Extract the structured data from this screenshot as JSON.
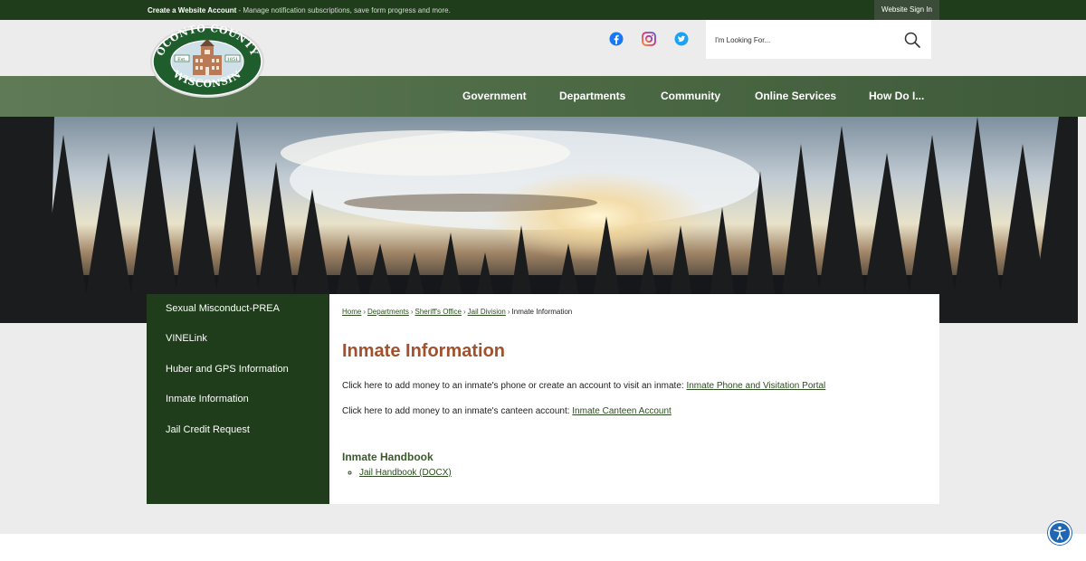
{
  "topbar": {
    "create_account": "Create a Website Account",
    "create_account_desc": " - Manage notification subscriptions, save form progress and more.",
    "sign_in": "Website Sign In"
  },
  "logo": {
    "name": "Oconto County Wisconsin logo",
    "top_text": "OCONTO COUNTY",
    "bottom_text": "WISCONSIN",
    "est": "Est.",
    "year": "1851"
  },
  "social": [
    {
      "name": "facebook-icon",
      "color": "#1877f2"
    },
    {
      "name": "instagram-icon",
      "color": "#c13584"
    },
    {
      "name": "twitter-icon",
      "color": "#1da1f2"
    }
  ],
  "search": {
    "placeholder": "I'm Looking For..."
  },
  "nav": {
    "items": [
      "Government",
      "Departments",
      "Community",
      "Online Services",
      "How Do I..."
    ]
  },
  "sidebar": {
    "items": [
      "Sexual Misconduct-PREA",
      "VINELink",
      "Huber and GPS Information",
      "Inmate Information",
      "Jail Credit Request"
    ]
  },
  "breadcrumb": {
    "items": [
      "Home",
      "Departments",
      "Sheriff's Office",
      "Jail Division"
    ],
    "current": "Inmate Information"
  },
  "page": {
    "title": "Inmate Information",
    "para1_text": "Click here to add money to an inmate's phone or create an account to visit an inmate: ",
    "para1_link": "Inmate Phone and Visitation Portal",
    "para2_text": "Click here to add money to an inmate's canteen account: ",
    "para2_link": "Inmate Canteen Account",
    "handbook_title": "Inmate Handbook",
    "handbook_link": "Jail Handbook (DOCX)"
  },
  "colors": {
    "dark_green": "#1f3d1b",
    "nav_green": "#4d6a46",
    "title_brown": "#a0522d",
    "accessibility_blue": "#1f66b3"
  }
}
